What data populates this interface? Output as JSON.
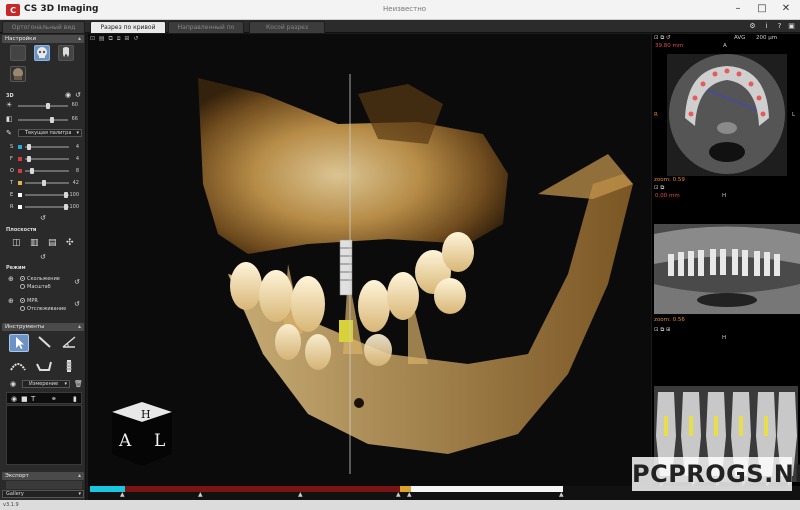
{
  "app": {
    "title": "CS 3D Imaging",
    "document_title": "Неизвестно"
  },
  "tabs": [
    {
      "label": "Ортогональный вид",
      "active": false
    },
    {
      "label": "Разрез по кривой",
      "active": true
    },
    {
      "label": "Направленный по кальциевом",
      "active": false
    },
    {
      "label": "Косой разрез",
      "active": false
    }
  ],
  "left_panel": {
    "settings_header": "Настройки",
    "threed_label": "3D",
    "slider_values": {
      "brightness": "60",
      "contrast": "66"
    },
    "palette_dropdown": "Текущая палитра",
    "channels": [
      {
        "letter": "S",
        "color": "#29a9e0",
        "value": "4"
      },
      {
        "letter": "F",
        "color": "#d23c3c",
        "value": "4"
      },
      {
        "letter": "O",
        "color": "#d23c3c",
        "value": "8"
      },
      {
        "letter": "T",
        "color": "#e0b24a",
        "value": "42"
      },
      {
        "letter": "E",
        "color": "#ffffff",
        "value": "100"
      },
      {
        "letter": "R",
        "color": "#ffffff",
        "value": "100"
      }
    ],
    "planes_header": "Плоскости",
    "mode_header": "Режим",
    "mode_options": [
      {
        "label": "Скольжение",
        "selected": true
      },
      {
        "label": "Масштаб",
        "selected": false
      }
    ],
    "projection_options": [
      {
        "label": "MPR",
        "selected": true
      },
      {
        "label": "Отслеживание",
        "selected": false
      }
    ],
    "tools_header": "Инструменты",
    "tools_dropdown": "Измерение",
    "export_header": "Экспорт",
    "gallery_label": "Gallery"
  },
  "right_panel": {
    "axial": {
      "distance": "39.80 mm",
      "orientation_top": "A",
      "orientation_left": "R",
      "orientation_right": "L",
      "zoom": "zoom: 0.59",
      "thickness": "200 µm",
      "mode": "AVG"
    },
    "panoramic": {
      "distance": "0.00 mm",
      "orientation_top": "H",
      "zoom": "zoom: 0.56",
      "mode": "AVG",
      "thickness": "200 µm"
    },
    "cross": {
      "orientation": "H",
      "labels": [
        "P",
        "F",
        "P",
        "F",
        "P",
        "F"
      ]
    }
  },
  "status": {
    "version": "v3.1.9"
  },
  "watermark": "PCPROGS.NET",
  "viewport": {
    "cube_labels": [
      "H",
      "A",
      "L"
    ]
  },
  "colors": {
    "accent": "#6c93c4",
    "panel": "#2a2a2a",
    "timeline_red": "#7a1414",
    "timeline_cyan": "#19c8e0"
  }
}
